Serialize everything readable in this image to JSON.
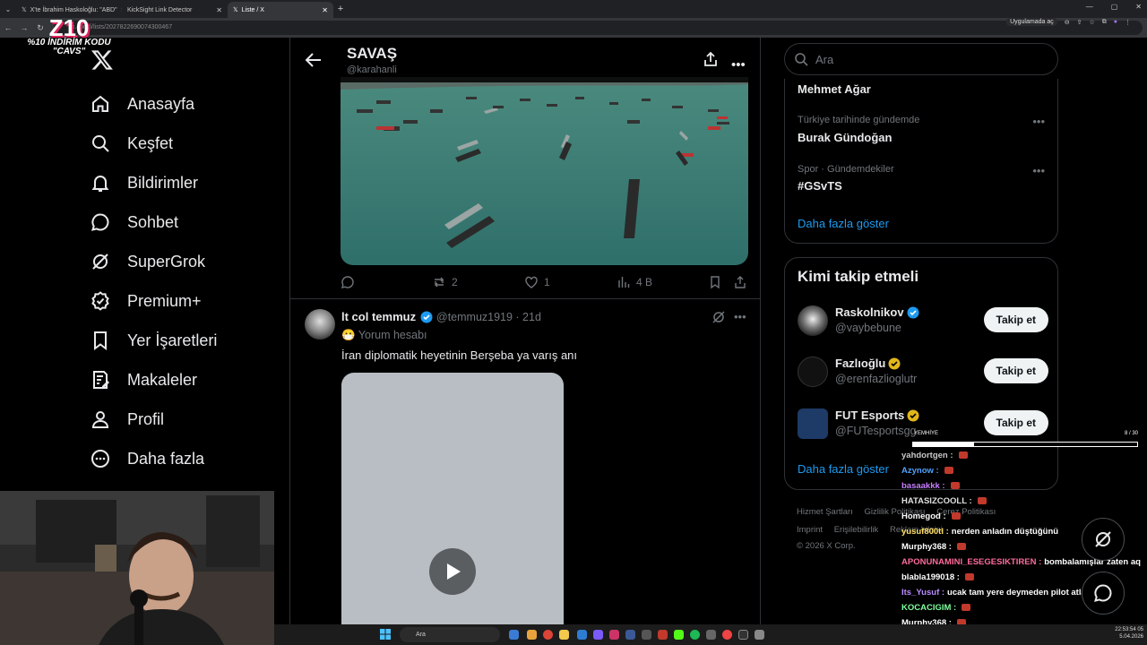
{
  "browser": {
    "tabs": [
      {
        "label": "X'te İbrahim Haskoloğlu: \"ABD\""
      },
      {
        "label": "KickSight Link Detector"
      },
      {
        "label": "Liste / X"
      }
    ],
    "url": "x.com/i/lists/2027822690074300467",
    "app_badge": "Uygulamada aç"
  },
  "overlay": {
    "brand_big": "Z10",
    "promo_line1": "%10 İNDİRİM KODU",
    "promo_line2": "\"CAVS\""
  },
  "sidebar": {
    "items": [
      {
        "label": "Anasayfa",
        "icon": "home-icon"
      },
      {
        "label": "Keşfet",
        "icon": "search-icon"
      },
      {
        "label": "Bildirimler",
        "icon": "bell-icon"
      },
      {
        "label": "Sohbet",
        "icon": "chat-icon"
      },
      {
        "label": "SuperGrok",
        "icon": "grok-icon"
      },
      {
        "label": "Premium+",
        "icon": "premium-icon"
      },
      {
        "label": "Yer İşaretleri",
        "icon": "bookmark-icon"
      },
      {
        "label": "Makaleler",
        "icon": "article-icon"
      },
      {
        "label": "Profil",
        "icon": "person-icon"
      },
      {
        "label": "Daha fazla",
        "icon": "more-circle-icon"
      }
    ]
  },
  "list_header": {
    "title": "SAVAŞ",
    "handle": "@karahanli"
  },
  "post1": {
    "replies": "",
    "reposts": "2",
    "likes": "1",
    "views": "4 B"
  },
  "post2": {
    "author": "lt col temmuz",
    "handle": "@temmuz1919 · 21d",
    "label": "Yorum hesabı",
    "text": "İran diplomatik heyetinin Berşeba ya varış anı"
  },
  "search": {
    "placeholder": "Ara"
  },
  "trends": [
    {
      "meta": "",
      "name": "Mehmet Ağar"
    },
    {
      "meta": "Türkiye tarihinde gündemde",
      "name": "Burak Gündoğan"
    },
    {
      "meta": "Spor · Gündemdekiler",
      "name": "#GSvTS"
    }
  ],
  "trends_more": "Daha fazla göster",
  "who_to_follow": {
    "title": "Kimi takip etmeli",
    "users": [
      {
        "name": "Raskolnikov",
        "handle": "@vaybebune",
        "button": "Takip et",
        "badge": "blue"
      },
      {
        "name": "Fazlıoğlu",
        "handle": "@erenfazlioglutr",
        "button": "Takip et",
        "badge": "gold"
      },
      {
        "name": "FUT Esports",
        "handle": "@FUTesportsgg",
        "button": "Takip et",
        "badge": "gold"
      }
    ],
    "more": "Daha fazla göster"
  },
  "footer": {
    "line1": [
      "Hizmet Şartları",
      "Gizlilik Politikası",
      "Çerez Politikası"
    ],
    "line2": [
      "Imprint",
      "Erişilebilirlik",
      "Reklam bilgisi"
    ],
    "copyright": "© 2026 X Corp."
  },
  "chat": {
    "goal_label": "YEMHİYE",
    "goal_count": "8 / 30",
    "goal_progress": 0.27,
    "messages": [
      {
        "user": "yahdortgen",
        "text": "",
        "color": "#c9c9c9",
        "emote": true
      },
      {
        "user": "Azynow",
        "text": "",
        "color": "#4fa3ff",
        "emote": true
      },
      {
        "user": "basaakkk",
        "text": "",
        "color": "#c77dff",
        "emote": true
      },
      {
        "user": "HATASIZCOOLL",
        "text": "",
        "color": "#e0e0e0",
        "emote": true
      },
      {
        "user": "Homegod",
        "text": "",
        "color": "#ffffff",
        "emote": true
      },
      {
        "user": "yusuf800tl",
        "text": "nerden anladın düştüğünü",
        "color": "#ffe066",
        "emote": false
      },
      {
        "user": "Murphy368",
        "text": "",
        "color": "#ffffff",
        "emote": true
      },
      {
        "user": "APONUNAMINI_ESEGESIKTIREN",
        "text": "bombalamışlar zaten aq",
        "color": "#ff6b9a",
        "emote": false
      },
      {
        "user": "blabla199018",
        "text": "",
        "color": "#ffffff",
        "emote": true
      },
      {
        "user": "Its_Yusuf",
        "text": "ucak tam yere deymeden pilot atlamis",
        "color": "#b98cff",
        "emote": false
      },
      {
        "user": "KOCACIGIM",
        "text": "",
        "color": "#7dff9e",
        "emote": true
      },
      {
        "user": "Murphy368",
        "text": "",
        "color": "#ffffff",
        "emote": true
      },
      {
        "user": "wuxs1",
        "text": "efe sallama ya",
        "color": "#b98cff",
        "emote": false
      }
    ]
  },
  "taskbar": {
    "search_placeholder": "Ara",
    "time": "22:53:54 05",
    "date": "5.04.2026"
  }
}
